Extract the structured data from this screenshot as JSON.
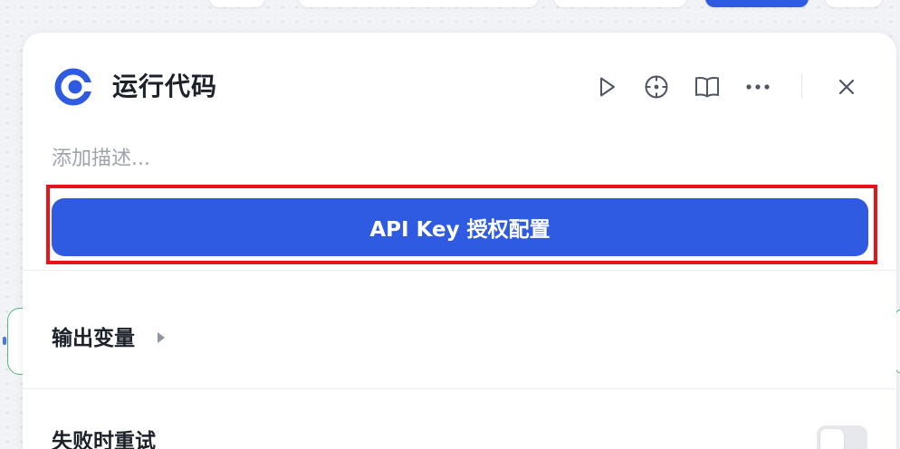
{
  "canvas": {
    "toolbar_pills": [
      "pill-1",
      "pill-2",
      "pill-3",
      "pill-4",
      "pill-5"
    ]
  },
  "node_panel": {
    "icon": "code-node-icon",
    "title": "运行代码",
    "description_placeholder": "添加描述...",
    "toolbar": {
      "run": "play-icon",
      "locate": "target-icon",
      "docs": "book-icon",
      "more": "more-icon",
      "close": "close-icon"
    },
    "auth_button_label": "API Key 授权配置",
    "sections": {
      "output_variables": "输出变量",
      "retry_on_failure": "失败时重试"
    },
    "retry_toggle_on": false
  },
  "colors": {
    "primary": "#2f5be3",
    "highlight_border": "#e8141b",
    "node_border": "#54b87a"
  }
}
